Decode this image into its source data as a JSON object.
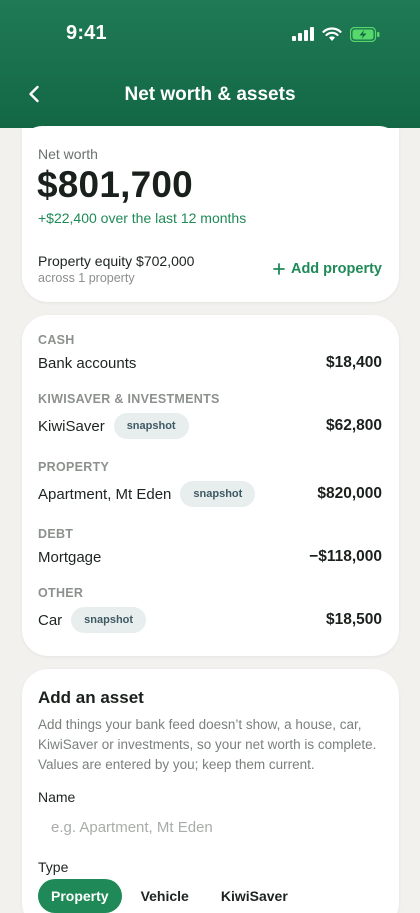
{
  "status_bar": {
    "time": "9:41"
  },
  "nav": {
    "title": "Net worth & assets"
  },
  "net_worth": {
    "label": "Net worth",
    "value": "$801,700",
    "change": "+$22,400 over the last 12 months",
    "equity_title": "Property equity $702,000",
    "equity_sub": "across 1 property",
    "add_property_label": "Add property"
  },
  "assets": {
    "cash": {
      "label": "CASH",
      "item": "Bank accounts",
      "value": "$18,400"
    },
    "kiwisaver": {
      "label": "KIWISAVER & INVESTMENTS",
      "item": "KiwiSaver",
      "chip": "snapshot",
      "value": "$62,800"
    },
    "property": {
      "label": "PROPERTY",
      "item": "Apartment, Mt Eden",
      "chip": "snapshot",
      "value": "$820,000"
    },
    "debt": {
      "label": "DEBT",
      "item": "Mortgage",
      "value": "−$118,000"
    },
    "other": {
      "label": "OTHER",
      "item": "Car",
      "chip": "snapshot",
      "value": "$18,500"
    }
  },
  "add_asset": {
    "title": "Add an asset",
    "description": "Add things your bank feed doesn’t show, a house, car, KiwiSaver or investments, so your net worth is complete. Values are entered by you; keep them current.",
    "name_label": "Name",
    "name_placeholder": "e.g. Apartment, Mt Eden",
    "name_value": "",
    "type_label": "Type",
    "types": [
      "Property",
      "Vehicle",
      "KiwiSaver"
    ],
    "selected_type": "Property"
  },
  "colors": {
    "header_green": "#1a7049",
    "accent_green": "#1f8a57",
    "chip_bg": "#e8eeee",
    "battery_green": "#56d86a"
  }
}
